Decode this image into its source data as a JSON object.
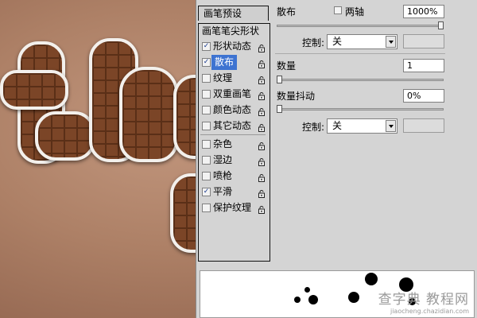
{
  "background": {
    "description_colors": {
      "base": "#ad8066",
      "chocolate": "#6b3a1f",
      "outline": "#f3f0ec"
    }
  },
  "panel": {
    "presets_label": "画笔预设",
    "items": [
      {
        "label": "画笔笔尖形状",
        "checked": null,
        "locked": false,
        "selected": false
      },
      {
        "label": "形状动态",
        "checked": true,
        "locked": true,
        "selected": false
      },
      {
        "label": "散布",
        "checked": true,
        "locked": true,
        "selected": true
      },
      {
        "label": "纹理",
        "checked": false,
        "locked": true,
        "selected": false
      },
      {
        "label": "双重画笔",
        "checked": false,
        "locked": true,
        "selected": false
      },
      {
        "label": "颜色动态",
        "checked": false,
        "locked": true,
        "selected": false
      },
      {
        "label": "其它动态",
        "checked": false,
        "locked": true,
        "selected": false
      },
      {
        "label": "杂色",
        "checked": false,
        "locked": true,
        "selected": false
      },
      {
        "label": "湿边",
        "checked": false,
        "locked": true,
        "selected": false
      },
      {
        "label": "喷枪",
        "checked": false,
        "locked": true,
        "selected": false
      },
      {
        "label": "平滑",
        "checked": true,
        "locked": true,
        "selected": false
      },
      {
        "label": "保护纹理",
        "checked": false,
        "locked": true,
        "selected": false
      }
    ],
    "scatter": {
      "label": "散布",
      "both_axes_label": "两轴",
      "both_axes_checked": false,
      "value": "1000%",
      "slider_fraction": 1.0
    },
    "control1": {
      "label": "控制:",
      "value": "关"
    },
    "count": {
      "label": "数量",
      "value": "1",
      "slider_fraction": 0.0
    },
    "count_jitter": {
      "label": "数量抖动",
      "value": "0%",
      "slider_fraction": 0.0
    },
    "control2": {
      "label": "控制:",
      "value": "关"
    }
  },
  "watermark": {
    "line1": "查字典 教程网",
    "line2": "jiaocheng.chazidian.com"
  }
}
